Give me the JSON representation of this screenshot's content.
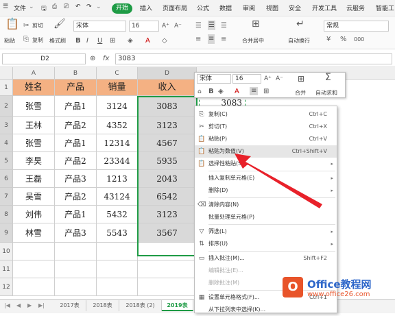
{
  "menu": {
    "file": "文件",
    "tabs": [
      "开始",
      "插入",
      "页面布局",
      "公式",
      "数据",
      "审阅",
      "视图",
      "安全",
      "开发工具",
      "云服务",
      "智能工"
    ]
  },
  "ribbon": {
    "cut": "剪切",
    "copy": "复制",
    "paste": "粘贴",
    "format_painter": "格式刷",
    "font": "宋体",
    "size": "16",
    "merge": "合并居中",
    "wrap": "自动换行",
    "numfmt": "常规"
  },
  "formula": {
    "cellref": "D2",
    "fx": "fx",
    "value": "3083"
  },
  "columns": [
    "A",
    "B",
    "C",
    "D"
  ],
  "rows": [
    "1",
    "2",
    "3",
    "4",
    "5",
    "6",
    "7",
    "8",
    "9",
    "10",
    "11",
    "12"
  ],
  "table": {
    "headers": [
      "姓名",
      "产品",
      "销量",
      "收入"
    ],
    "data": [
      [
        "张雪",
        "产品1",
        "3124",
        "3083"
      ],
      [
        "王林",
        "产品2",
        "4352",
        "3123"
      ],
      [
        "张雪",
        "产品1",
        "12314",
        "4567"
      ],
      [
        "李昊",
        "产品2",
        "23344",
        "5935"
      ],
      [
        "王磊",
        "产品3",
        "1213",
        "2043"
      ],
      [
        "吴雪",
        "产品2",
        "43124",
        "6542"
      ],
      [
        "刘伟",
        "产品1",
        "5432",
        "3123"
      ],
      [
        "林雪",
        "产品3",
        "5543",
        "3567"
      ]
    ]
  },
  "mini": {
    "font": "宋体",
    "size": "16",
    "merge": "合并",
    "autosum": "自动求和",
    "sigma": "Σ"
  },
  "pasted_value": "3083",
  "context_menu": [
    {
      "label": "复制(C)",
      "shortcut": "Ctrl+C",
      "icon": "⎘"
    },
    {
      "label": "剪切(T)",
      "shortcut": "Ctrl+X",
      "icon": "✂"
    },
    {
      "label": "粘贴(P)",
      "shortcut": "Ctrl+V",
      "icon": "📋"
    },
    {
      "label": "粘贴为数值(V)",
      "shortcut": "Ctrl+Shift+V",
      "icon": "📋"
    },
    {
      "label": "选择性粘贴(S)...",
      "shortcut": "",
      "icon": "📋"
    },
    {
      "label": "插入复制单元格(E)",
      "shortcut": "",
      "icon": ""
    },
    {
      "label": "删除(D)",
      "shortcut": "",
      "icon": ""
    },
    {
      "label": "清除内容(N)",
      "shortcut": "",
      "icon": "⌫"
    },
    {
      "label": "批量处理单元格(P)",
      "shortcut": "",
      "icon": ""
    },
    {
      "label": "筛选(L)",
      "shortcut": "",
      "icon": "▽"
    },
    {
      "label": "排序(U)",
      "shortcut": "",
      "icon": "⇅"
    },
    {
      "label": "插入批注(M)...",
      "shortcut": "Shift+F2",
      "icon": "▭"
    },
    {
      "label": "编辑批注(E)...",
      "shortcut": "",
      "icon": ""
    },
    {
      "label": "删除批注(M)",
      "shortcut": "",
      "icon": ""
    },
    {
      "label": "设置单元格格式(F)...",
      "shortcut": "Ctrl+1",
      "icon": "▦"
    },
    {
      "label": "从下拉列表中选择(K)...",
      "shortcut": "",
      "icon": ""
    }
  ],
  "sheet_tabs": [
    "2017表",
    "2018表",
    "2018表 (2)",
    "2019表"
  ],
  "watermark": {
    "title": "Office教程网",
    "url": "www.office26.com"
  },
  "colors": {
    "header_fill": "#f4b183",
    "selection": "#1e9b45",
    "arrow": "#e8212a",
    "accent": "#1e9b45"
  }
}
